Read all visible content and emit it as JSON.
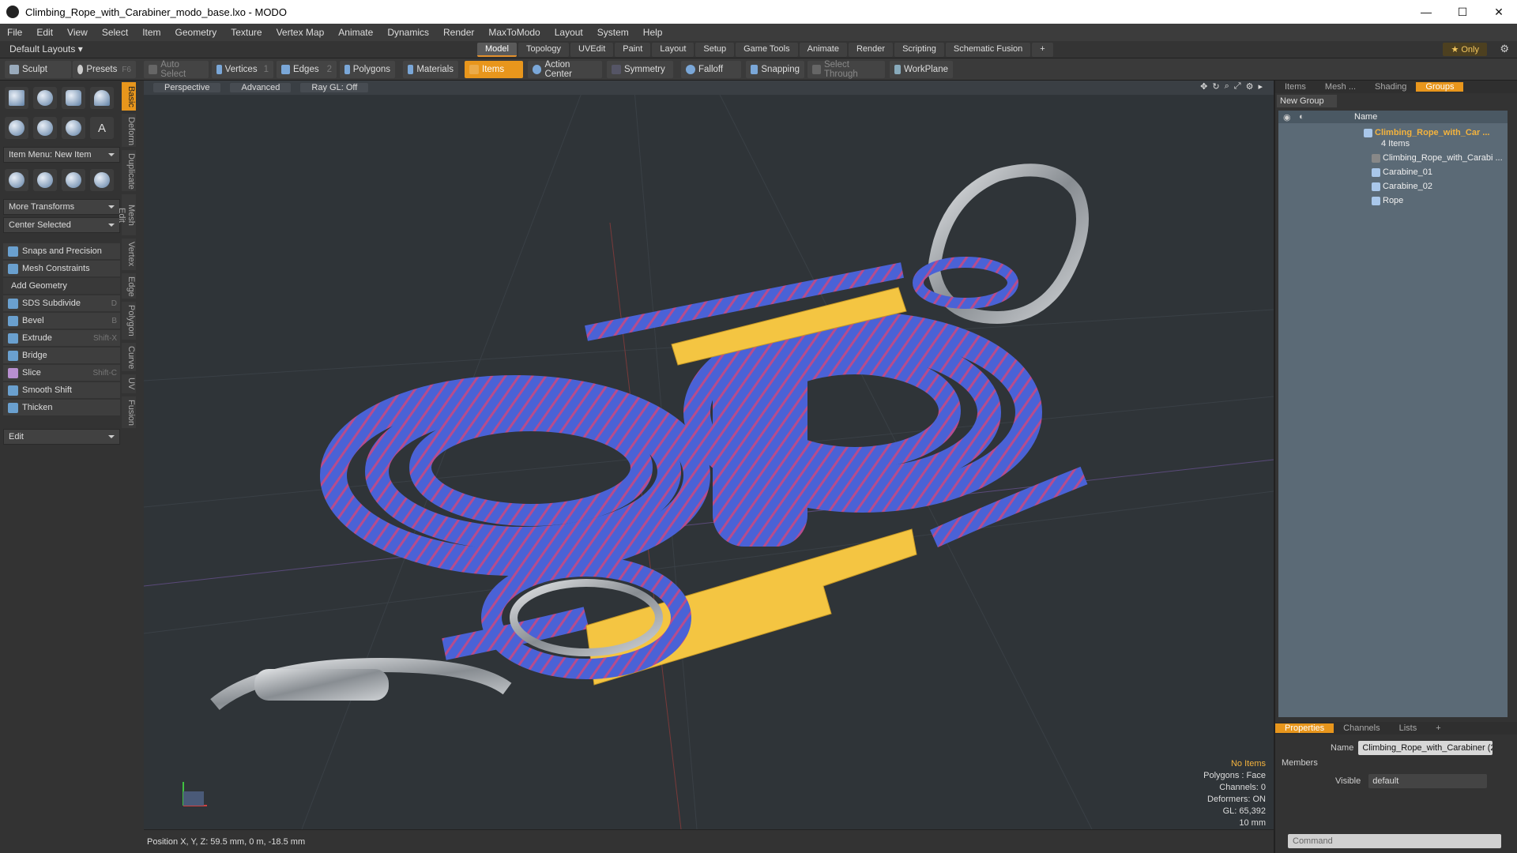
{
  "window": {
    "title": "Climbing_Rope_with_Carabiner_modo_base.lxo - MODO"
  },
  "menu": [
    "File",
    "Edit",
    "View",
    "Select",
    "Item",
    "Geometry",
    "Texture",
    "Vertex Map",
    "Animate",
    "Dynamics",
    "Render",
    "MaxToModo",
    "Layout",
    "System",
    "Help"
  ],
  "layoutbar": {
    "default_layouts": "Default Layouts ▾",
    "tabs": [
      "Model",
      "Topology",
      "UVEdit",
      "Paint",
      "Layout",
      "Setup",
      "Game Tools",
      "Animate",
      "Render",
      "Scripting",
      "Schematic Fusion",
      "+"
    ],
    "active_tab": "Model",
    "only": "★  Only"
  },
  "toolbar": {
    "sculpt": "Sculpt",
    "presets": "Presets",
    "presets_key": "F6",
    "auto_select": "Auto Select",
    "vertices": "Vertices",
    "vertices_n": "1",
    "edges": "Edges",
    "edges_n": "2",
    "polygons": "Polygons",
    "materials": "Materials",
    "items": "Items",
    "action_center": "Action Center",
    "symmetry": "Symmetry",
    "falloff": "Falloff",
    "snapping": "Snapping",
    "select_through": "Select Through",
    "workplane": "WorkPlane"
  },
  "leftpanel": {
    "item_menu": "Item Menu: New Item",
    "more_transforms": "More Transforms",
    "center_selected": "Center Selected",
    "snaps": "Snaps and Precision",
    "mesh_constraints": "Mesh Constraints",
    "add_geometry": "Add Geometry",
    "tools": [
      {
        "label": "SDS Subdivide",
        "key": "D"
      },
      {
        "label": "Bevel",
        "key": "B"
      },
      {
        "label": "Extrude",
        "key": "Shift-X"
      },
      {
        "label": "Bridge",
        "key": ""
      },
      {
        "label": "Slice",
        "key": "Shift-C"
      },
      {
        "label": "Smooth Shift",
        "key": ""
      },
      {
        "label": "Thicken",
        "key": ""
      }
    ],
    "edit": "Edit",
    "vtabs": [
      "Basic",
      "Deform",
      "Duplicate",
      "Mesh Edit",
      "Vertex",
      "Edge",
      "Polygon",
      "Curve",
      "UV",
      "Fusion"
    ]
  },
  "viewport": {
    "perspective": "Perspective",
    "advanced": "Advanced",
    "raygl": "Ray GL: Off",
    "info": {
      "no_items": "No Items",
      "polygons": "Polygons : Face",
      "channels": "Channels: 0",
      "deformers": "Deformers: ON",
      "gl": "GL: 65,392",
      "scale": "10 mm"
    }
  },
  "status": {
    "position": "Position X, Y, Z:  59.5 mm, 0 m, -18.5 mm"
  },
  "rightpanel": {
    "tabs": [
      "Items",
      "Mesh ...",
      "Shading",
      "Groups"
    ],
    "new_group": "New Group",
    "name_col": "Name",
    "group": "Climbing_Rope_with_Car ...",
    "group_count": "4 Items",
    "children": [
      "Climbing_Rope_with_Carabi ...",
      "Carabine_01",
      "Carabine_02",
      "Rope"
    ],
    "prop_tabs": [
      "Properties",
      "Channels",
      "Lists",
      "+"
    ],
    "name_label": "Name",
    "name_value": "Climbing_Rope_with_Carabiner (2",
    "members": "Members",
    "visible_label": "Visible",
    "visible_value": "default",
    "command": "Command"
  },
  "colors": {
    "accent": "#e8961c",
    "rope": "#4a62d6",
    "rope_stripe": "#d2467a",
    "sleeve": "#f4c542",
    "metal": "#9aa0a6"
  }
}
